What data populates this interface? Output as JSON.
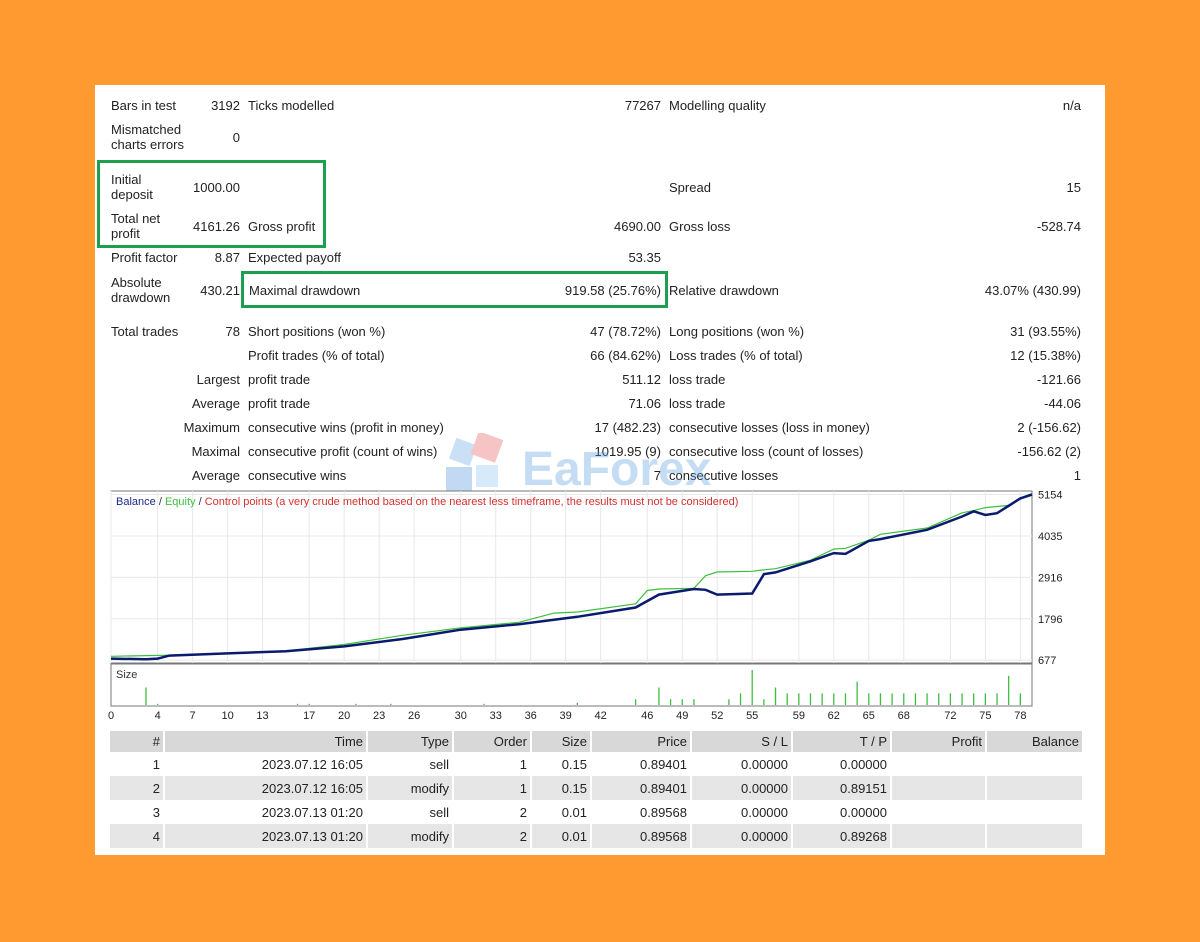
{
  "summary": {
    "bars_label": "Bars in test",
    "bars_value": "3192",
    "ticks_label": "Ticks modelled",
    "ticks_value": "77267",
    "quality_label": "Modelling quality",
    "quality_value": "n/a",
    "mismatch_label": "Mismatched charts errors",
    "mismatch_value": "0",
    "deposit_label": "Initial deposit",
    "deposit_value": "1000.00",
    "spread_label": "Spread",
    "spread_value": "15",
    "net_label": "Total net profit",
    "net_value": "4161.26",
    "gross_profit_label": "Gross profit",
    "gross_profit_value": "4690.00",
    "gross_loss_label": "Gross loss",
    "gross_loss_value": "-528.74",
    "pf_label": "Profit factor",
    "pf_value": "8.87",
    "payoff_label": "Expected payoff",
    "payoff_value": "53.35",
    "abs_dd_label": "Absolute drawdown",
    "abs_dd_value": "430.21",
    "max_dd_label": "Maximal drawdown",
    "max_dd_value": "919.58 (25.76%)",
    "rel_dd_label": "Relative drawdown",
    "rel_dd_value": "43.07% (430.99)",
    "trades_label": "Total trades",
    "trades_value": "78",
    "short_label": "Short positions (won %)",
    "short_value": "47 (78.72%)",
    "long_label": "Long positions (won %)",
    "long_value": "31 (93.55%)",
    "ptrades_label": "Profit trades (% of total)",
    "ptrades_value": "66 (84.62%)",
    "ltrades_label": "Loss trades (% of total)",
    "ltrades_value": "12 (15.38%)",
    "largest_label": "Largest",
    "largest_profit_label": "profit trade",
    "largest_profit_value": "511.12",
    "largest_loss_label": "loss trade",
    "largest_loss_value": "-121.66",
    "average_label": "Average",
    "average_profit_label": "profit trade",
    "average_profit_value": "71.06",
    "average_loss_label": "loss trade",
    "average_loss_value": "-44.06",
    "maximum_label": "Maximum",
    "max_wins_label": "consecutive wins (profit in money)",
    "max_wins_value": "17 (482.23)",
    "max_losses_label": "consecutive losses (loss in money)",
    "max_losses_value": "2 (-156.62)",
    "maximal_label": "Maximal",
    "maximal_profit_label": "consecutive profit (count of wins)",
    "maximal_profit_value": "1019.95 (9)",
    "maximal_loss_label": "consecutive loss (count of losses)",
    "maximal_loss_value": "-156.62 (2)",
    "avg2_label": "Average",
    "avg_wins_label": "consecutive wins",
    "avg_wins_value": "7",
    "avg_losses_label": "consecutive losses",
    "avg_losses_value": "1"
  },
  "watermark_text": "EaForex",
  "chart_data": {
    "type": "line",
    "legend": {
      "balance": "Balance",
      "sep1": " / ",
      "equity": "Equity",
      "sep2": " / ",
      "control": "Control points (a very crude method based on the nearest less timeframe, the results must not be considered)"
    },
    "y_ticks": [
      "5154",
      "4035",
      "2916",
      "1796",
      "677"
    ],
    "y_tick_values": [
      5154,
      4035,
      2916,
      1796,
      677
    ],
    "ylim": [
      600,
      5250
    ],
    "xlim": [
      0,
      79
    ],
    "x_ticks": [
      "0",
      "4",
      "7",
      "10",
      "13",
      "17",
      "20",
      "23",
      "26",
      "30",
      "33",
      "36",
      "39",
      "42",
      "46",
      "49",
      "52",
      "55",
      "59",
      "62",
      "65",
      "68",
      "72",
      "75",
      "78"
    ],
    "x_tick_values": [
      0,
      4,
      7,
      10,
      13,
      17,
      20,
      23,
      26,
      30,
      33,
      36,
      39,
      42,
      46,
      49,
      52,
      55,
      59,
      62,
      65,
      68,
      72,
      75,
      78
    ],
    "size_label": "Size",
    "colors": {
      "balance": "#0a1a6e",
      "equity": "#3dbf3d",
      "control": "#d63030",
      "legend_balance": "#1a2a8a"
    },
    "series": [
      {
        "name": "Balance",
        "x": [
          0,
          3,
          4,
          5,
          10,
          15,
          20,
          25,
          30,
          35,
          40,
          45,
          47,
          50,
          51,
          52,
          55,
          56,
          57,
          60,
          62,
          63,
          65,
          66,
          70,
          73,
          74,
          75,
          76,
          77,
          78,
          79
        ],
        "y": [
          720,
          700,
          720,
          800,
          860,
          920,
          1050,
          1250,
          1500,
          1650,
          1850,
          2100,
          2450,
          2600,
          2580,
          2450,
          2480,
          3000,
          3050,
          3350,
          3570,
          3550,
          3900,
          3950,
          4200,
          4560,
          4700,
          4600,
          4650,
          4850,
          5050,
          5154
        ]
      },
      {
        "name": "Equity",
        "x": [
          0,
          3,
          5,
          10,
          15,
          20,
          25,
          30,
          35,
          38,
          40,
          45,
          46,
          47,
          50,
          51,
          52,
          55,
          56,
          57,
          60,
          62,
          63,
          65,
          66,
          70,
          73,
          74,
          75,
          77,
          78,
          79
        ],
        "y": [
          780,
          800,
          810,
          870,
          930,
          1100,
          1350,
          1550,
          1700,
          1950,
          1980,
          2200,
          2560,
          2600,
          2620,
          2960,
          3060,
          3080,
          3120,
          3150,
          3380,
          3680,
          3700,
          3920,
          4080,
          4250,
          4660,
          4720,
          4800,
          4860,
          5060,
          5180
        ]
      }
    ],
    "sizes": [
      {
        "x": 3,
        "v": 0.15
      },
      {
        "x": 4,
        "v": 0.01
      },
      {
        "x": 16,
        "v": 0.01
      },
      {
        "x": 17,
        "v": 0.01
      },
      {
        "x": 21,
        "v": 0.01
      },
      {
        "x": 24,
        "v": 0.01
      },
      {
        "x": 32,
        "v": 0.01
      },
      {
        "x": 40,
        "v": 0.02
      },
      {
        "x": 45,
        "v": 0.05
      },
      {
        "x": 47,
        "v": 0.15
      },
      {
        "x": 48,
        "v": 0.05
      },
      {
        "x": 49,
        "v": 0.05
      },
      {
        "x": 50,
        "v": 0.05
      },
      {
        "x": 53,
        "v": 0.05
      },
      {
        "x": 54,
        "v": 0.1
      },
      {
        "x": 55,
        "v": 0.3
      },
      {
        "x": 56,
        "v": 0.05
      },
      {
        "x": 57,
        "v": 0.15
      },
      {
        "x": 58,
        "v": 0.1
      },
      {
        "x": 59,
        "v": 0.1
      },
      {
        "x": 60,
        "v": 0.1
      },
      {
        "x": 61,
        "v": 0.1
      },
      {
        "x": 62,
        "v": 0.1
      },
      {
        "x": 63,
        "v": 0.1
      },
      {
        "x": 64,
        "v": 0.2
      },
      {
        "x": 65,
        "v": 0.1
      },
      {
        "x": 66,
        "v": 0.1
      },
      {
        "x": 67,
        "v": 0.1
      },
      {
        "x": 68,
        "v": 0.1
      },
      {
        "x": 69,
        "v": 0.1
      },
      {
        "x": 70,
        "v": 0.1
      },
      {
        "x": 71,
        "v": 0.1
      },
      {
        "x": 72,
        "v": 0.1
      },
      {
        "x": 73,
        "v": 0.1
      },
      {
        "x": 74,
        "v": 0.1
      },
      {
        "x": 75,
        "v": 0.1
      },
      {
        "x": 76,
        "v": 0.1
      },
      {
        "x": 77,
        "v": 0.25
      },
      {
        "x": 78,
        "v": 0.1
      }
    ]
  },
  "deals": {
    "headers": [
      "#",
      "Time",
      "Type",
      "Order",
      "Size",
      "Price",
      "S / L",
      "T / P",
      "Profit",
      "Balance"
    ],
    "rows": [
      [
        "1",
        "2023.07.12 16:05",
        "sell",
        "1",
        "0.15",
        "0.89401",
        "0.00000",
        "0.00000",
        "",
        ""
      ],
      [
        "2",
        "2023.07.12 16:05",
        "modify",
        "1",
        "0.15",
        "0.89401",
        "0.00000",
        "0.89151",
        "",
        ""
      ],
      [
        "3",
        "2023.07.13 01:20",
        "sell",
        "2",
        "0.01",
        "0.89568",
        "0.00000",
        "0.00000",
        "",
        ""
      ],
      [
        "4",
        "2023.07.13 01:20",
        "modify",
        "2",
        "0.01",
        "0.89568",
        "0.00000",
        "0.89268",
        "",
        ""
      ]
    ]
  }
}
